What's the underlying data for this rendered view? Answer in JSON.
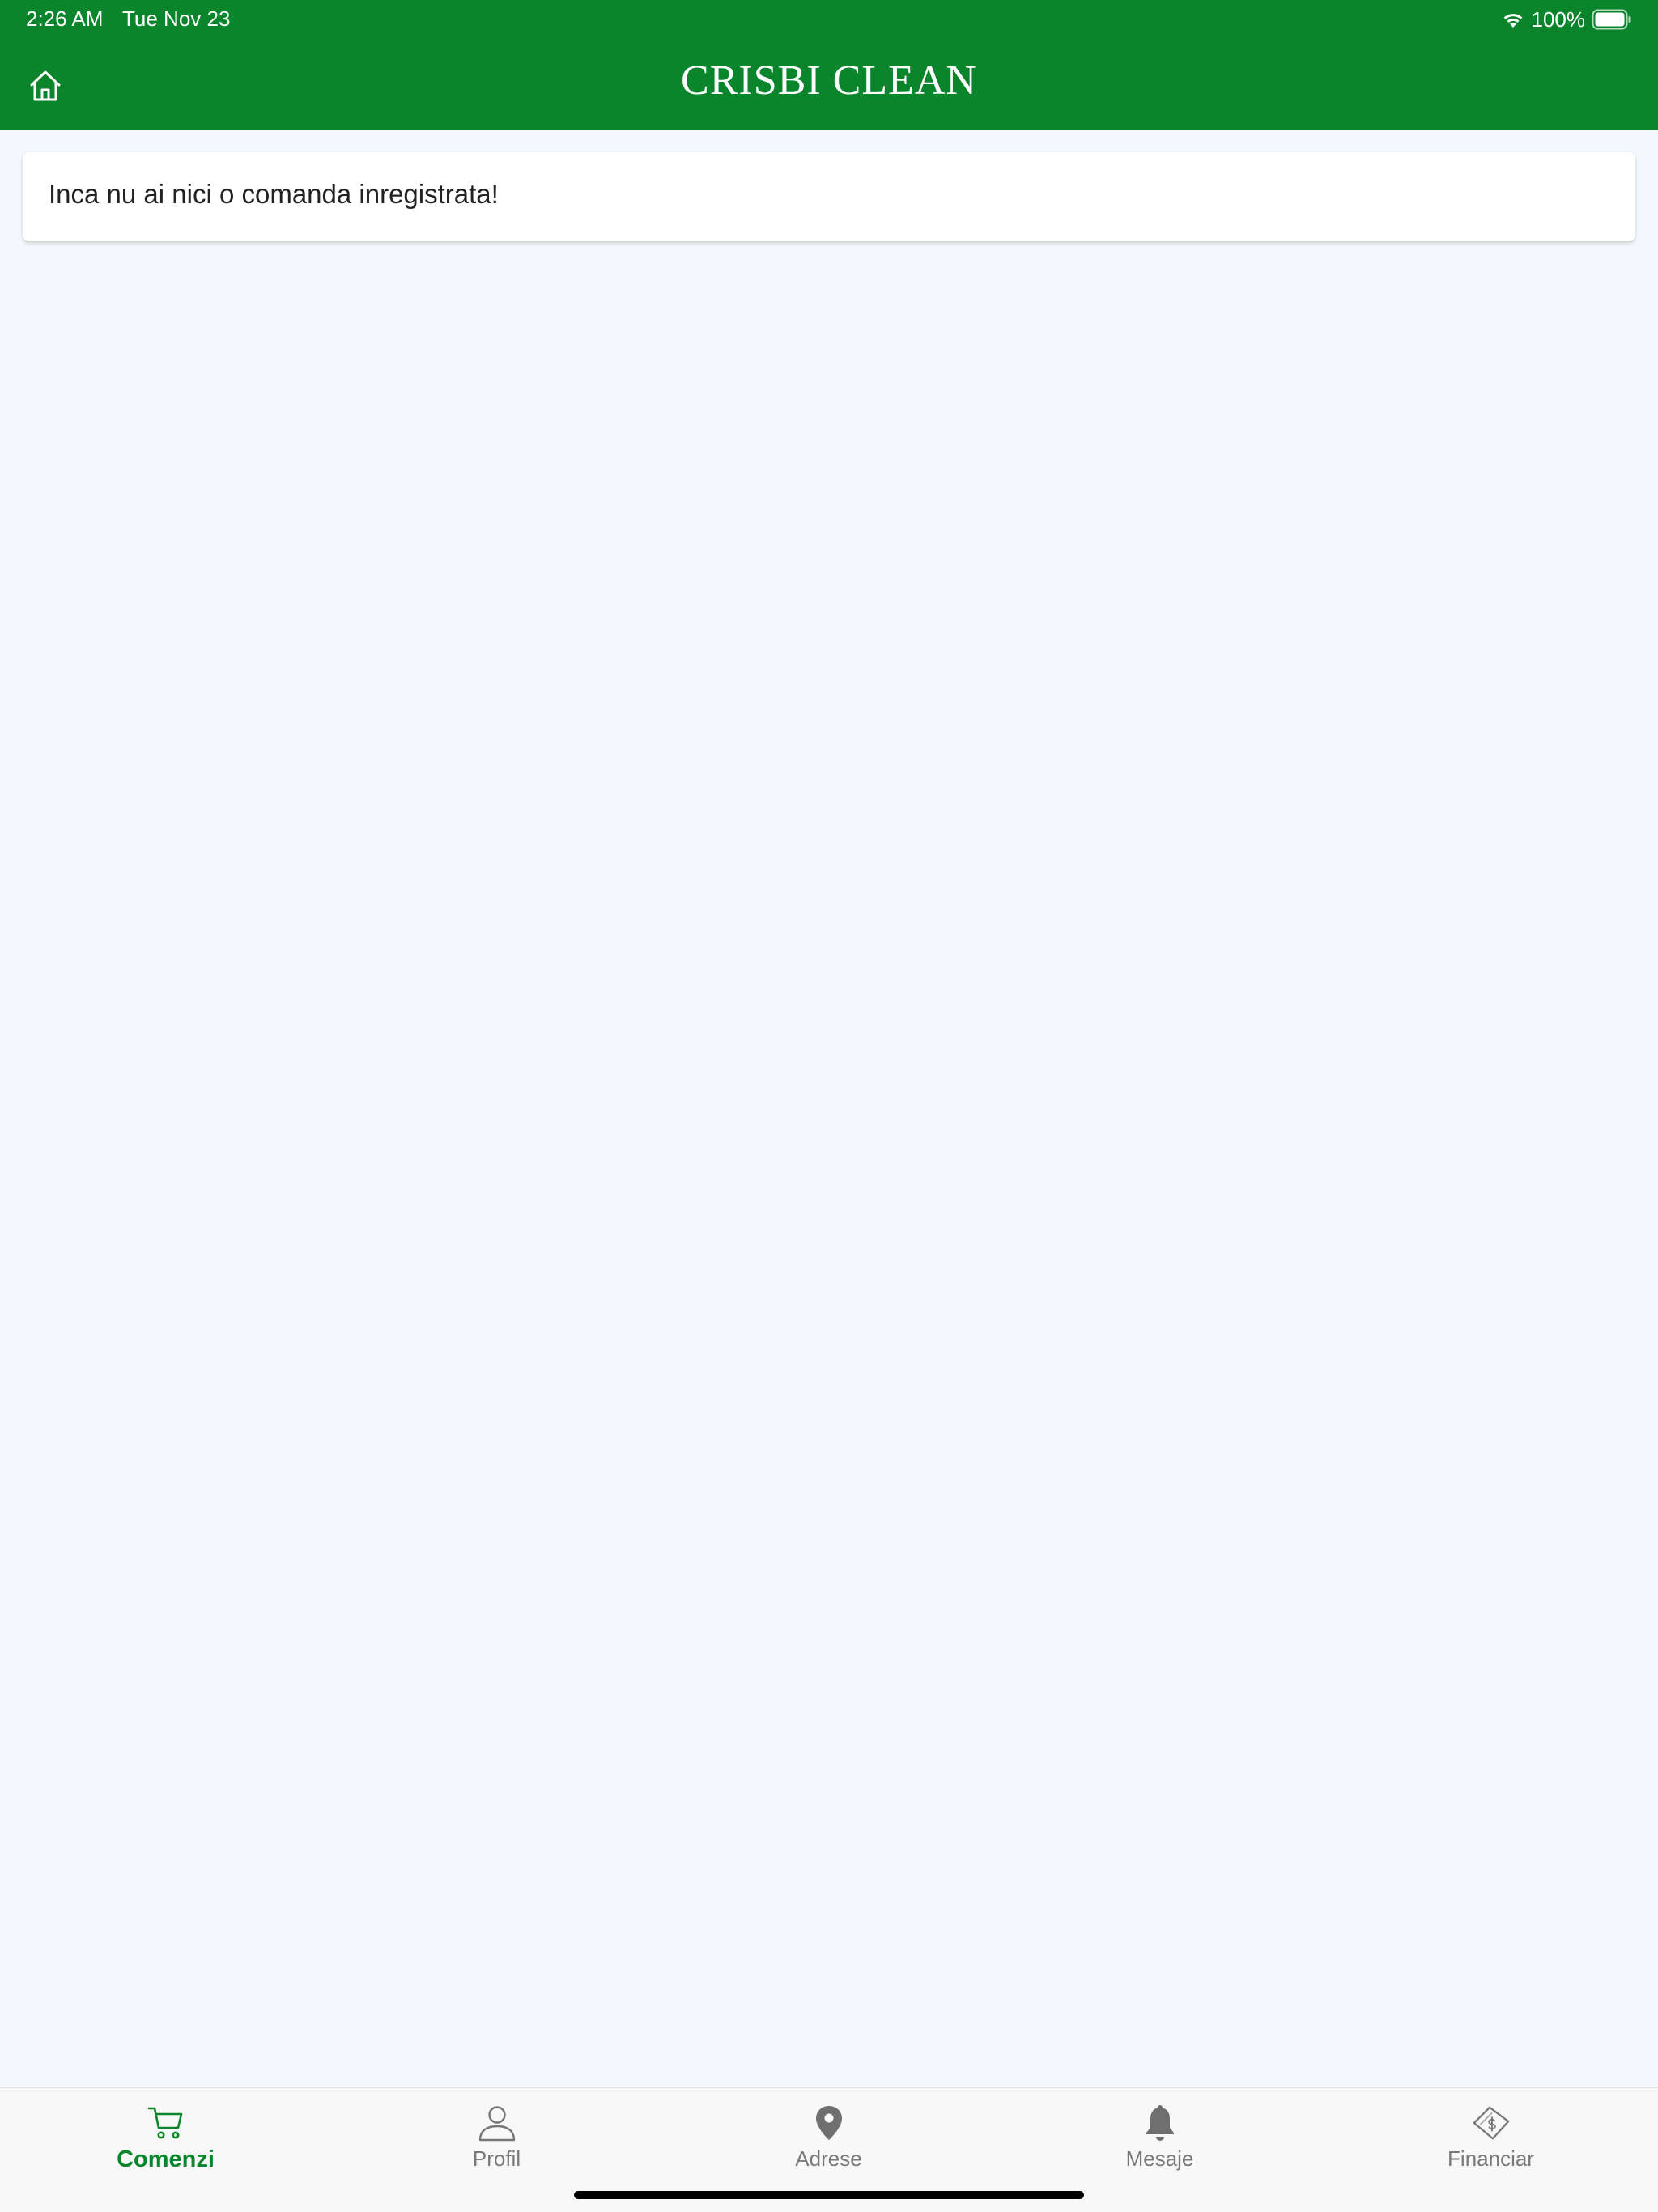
{
  "status_bar": {
    "time": "2:26 AM",
    "date": "Tue Nov 23",
    "battery": "100%"
  },
  "header": {
    "title": "CRISBI CLEAN"
  },
  "main": {
    "empty_message": "Inca nu ai nici o comanda inregistrata!"
  },
  "tabbar": {
    "tabs": [
      {
        "label": "Comenzi",
        "icon": "cart-icon",
        "active": true
      },
      {
        "label": "Profil",
        "icon": "user-icon",
        "active": false
      },
      {
        "label": "Adrese",
        "icon": "location-pin-icon",
        "active": false
      },
      {
        "label": "Mesaje",
        "icon": "bell-icon",
        "active": false
      },
      {
        "label": "Financiar",
        "icon": "money-bill-icon",
        "active": false
      }
    ]
  },
  "colors": {
    "brand": "#0a852b",
    "background": "#f4f8fd",
    "inactive_tab": "#7a7a7a"
  }
}
